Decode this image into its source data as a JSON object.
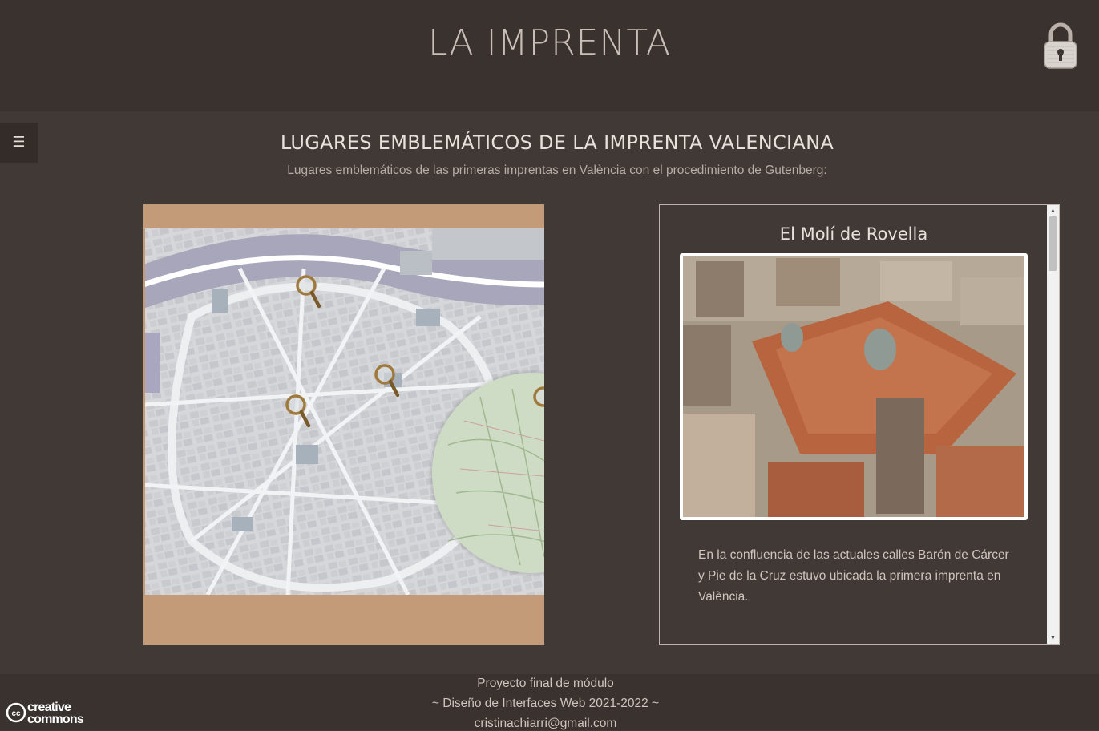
{
  "header": {
    "title": "LA IMPRENTA",
    "lock_icon": "padlock-icon"
  },
  "menu": {
    "toggle_glyph": "☰",
    "icon": "hamburger-menu-icon"
  },
  "page": {
    "heading": "LUGARES EMBLEMÁTICOS DE LA IMPRENTA VALENCIANA",
    "subheading": "Lugares emblemáticos de las primeras imprentas en València con el procedimiento de Gutenberg:"
  },
  "map": {
    "icon": "city-map",
    "markers": [
      {
        "name": "magnifier-marker-1",
        "icon": "magnifying-glass-icon"
      },
      {
        "name": "magnifier-marker-2",
        "icon": "magnifying-glass-icon"
      },
      {
        "name": "magnifier-marker-3",
        "icon": "magnifying-glass-icon"
      },
      {
        "name": "magnifier-marker-4",
        "icon": "magnifying-glass-icon"
      }
    ]
  },
  "info_panel": {
    "title": "El Molí de Rovella",
    "photo_icon": "aerial-market-photo",
    "description": "En la confluencia de las actuales calles Barón de Cárcer y Pie de la Cruz estuvo ubicada la primera imprenta en València."
  },
  "footer": {
    "line1": "Proyecto final de módulo",
    "line2": "~ Diseño de Interfaces Web 2021-2022 ~",
    "line3": "cristinachiarri@gmail.com",
    "cc_text": "creative commons",
    "cc_icon": "creative-commons-icon"
  },
  "colors": {
    "page_bg": "#403935",
    "header_bg": "#39322e",
    "map_frame": "#c39b78",
    "map_water": "#9aa0be",
    "roof_orange": "#b8653f"
  }
}
